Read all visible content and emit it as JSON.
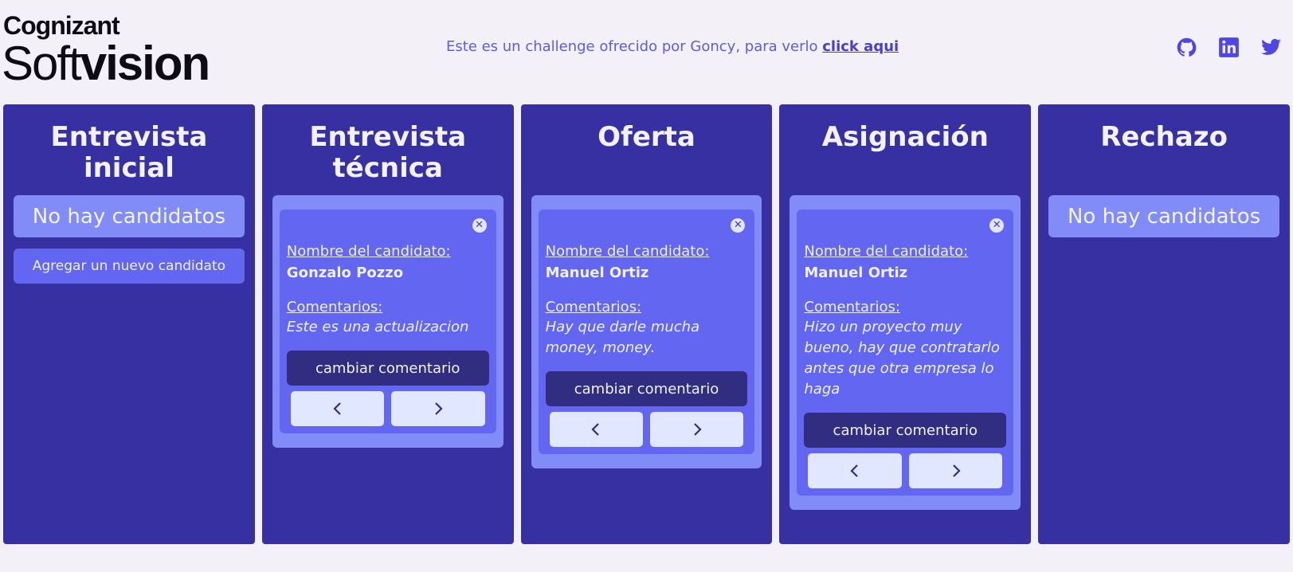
{
  "header": {
    "logo_top": "Cognizant",
    "logo_bottom_a": "Soft",
    "logo_bottom_b": "vision",
    "challenge_text": "Este es un challenge ofrecido por Goncy, para verlo ",
    "challenge_link": "click aqui",
    "socials": [
      "github-icon",
      "linkedin-icon",
      "twitter-icon"
    ]
  },
  "colors": {
    "background": "#f4f0f8",
    "column": "#3730a3",
    "card_wrap": "#818cf8",
    "card": "#6366f1",
    "button_dark": "#312e81",
    "nav_button": "#e0e7ff",
    "accent_text": "#5a5ce8"
  },
  "labels": {
    "name_label": "Nombre del candidato:",
    "comments_label": "Comentarios:",
    "change_comment": "cambiar comentario",
    "empty": "No hay candidatos",
    "add_candidate": "Agregar un nuevo candidato"
  },
  "columns": [
    {
      "title": "Entrevista inicial",
      "empty": "No hay candidatos",
      "add_button": "Agregar un nuevo candidato"
    },
    {
      "title": "Entrevista técnica",
      "candidate": {
        "name": "Gonzalo Pozzo",
        "comment": "Este es una actualizacion"
      }
    },
    {
      "title": "Oferta",
      "candidate": {
        "name": "Manuel Ortiz",
        "comment": "Hay que darle mucha money, money."
      }
    },
    {
      "title": "Asignación",
      "candidate": {
        "name": "Manuel Ortiz",
        "comment": "Hizo un proyecto muy bueno, hay que contratarlo antes que otra empresa lo haga"
      }
    },
    {
      "title": "Rechazo",
      "empty": "No hay candidatos"
    }
  ]
}
